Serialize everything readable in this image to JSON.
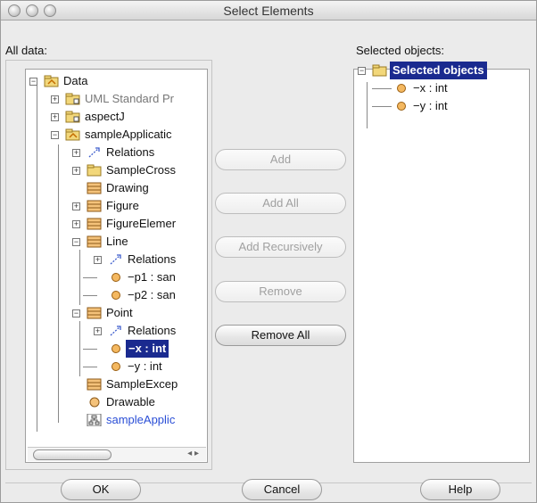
{
  "window": {
    "title": "Select Elements"
  },
  "left": {
    "label": "All data:",
    "items": [
      "Data",
      "UML Standard Pr",
      "aspectJ",
      "sampleApplicatic",
      "Relations",
      "SampleCross",
      "Drawing",
      "Figure",
      "FigureElemer",
      "Line",
      "Relations",
      "−p1 : san",
      "−p2 : san",
      "Point",
      "Relations",
      "−x : int",
      "−y : int",
      "SampleExcep",
      "Drawable",
      "sampleApplic"
    ]
  },
  "right": {
    "label": "Selected objects:",
    "items": [
      "Selected objects",
      "−x : int",
      "−y : int"
    ]
  },
  "buttons": {
    "add": "Add",
    "add_all": "Add All",
    "add_recursively": "Add Recursively",
    "remove": "Remove",
    "remove_all": "Remove All",
    "ok": "OK",
    "cancel": "Cancel",
    "help": "Help"
  },
  "colors": {
    "selection": "#1a2a8f",
    "folder": "#f2d77a",
    "attribute": "#f4b860",
    "link": "#2a4ed6"
  }
}
